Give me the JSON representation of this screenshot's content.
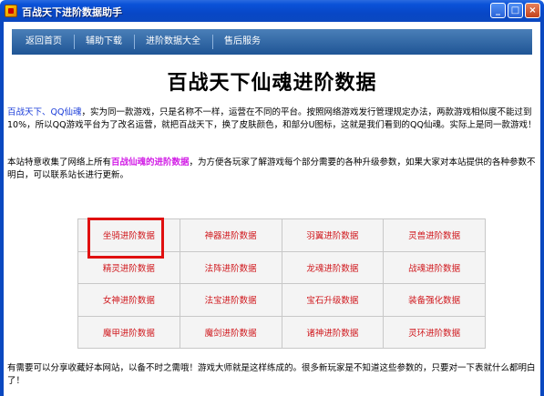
{
  "window": {
    "title": "百战天下进阶数据助手",
    "controls": {
      "minimize": "_",
      "maximize": "□",
      "close": "×"
    }
  },
  "nav": {
    "items": [
      {
        "label": "返回首页"
      },
      {
        "label": "辅助下载"
      },
      {
        "label": "进阶数据大全"
      },
      {
        "label": "售后服务"
      }
    ]
  },
  "main": {
    "title": "百战天下仙魂进阶数据",
    "intro": {
      "link1": "百战天下",
      "sep": "、",
      "link2": "QQ仙魂",
      "text": "，实为同一款游戏，只是名称不一样，运营在不同的平台。按照网络游戏发行管理规定办法，两款游戏相似度不能过到10%，所以QQ游戏平台为了改名运营，就把百战天下，换了皮肤颜色，和部分U图标，这就是我们看到的QQ仙魂。实际上是同一款游戏！"
    },
    "notice": {
      "before": "本站特意收集了网络上所有",
      "highlight": "百战仙魂的进阶数据",
      "after": "，为方便各玩家了解游戏每个部分需要的各种升级参数，如果大家对本站提供的各种参数不明白，可以联系站长进行更新。"
    },
    "grid": [
      [
        "坐骑进阶数据",
        "神器进阶数据",
        "羽翼进阶数据",
        "灵兽进阶数据"
      ],
      [
        "精灵进阶数据",
        "法阵进阶数据",
        "龙魂进阶数据",
        "战魂进阶数据"
      ],
      [
        "女神进阶数据",
        "法宝进阶数据",
        "宝石升级数据",
        "装备强化数据"
      ],
      [
        "魔甲进阶数据",
        "魔剑进阶数据",
        "诸神进阶数据",
        "灵环进阶数据"
      ]
    ],
    "footer": "有需要可以分享收藏好本网站，以备不时之需哦！游戏大师就是这样练成的。很多新玩家是不知道这些参数的，只要对一下表就什么都明白了！"
  },
  "colors": {
    "titlebar": "#0a52d8",
    "nav": "#2a5f9e",
    "grid_text": "#d0191e",
    "link_blue": "#1a3cd9",
    "highlight_pink": "#d21ee6",
    "selection_box": "#e01010"
  },
  "icons": {
    "app": "app-icon",
    "minimize": "minimize-icon",
    "maximize": "maximize-icon",
    "close": "close-icon"
  }
}
